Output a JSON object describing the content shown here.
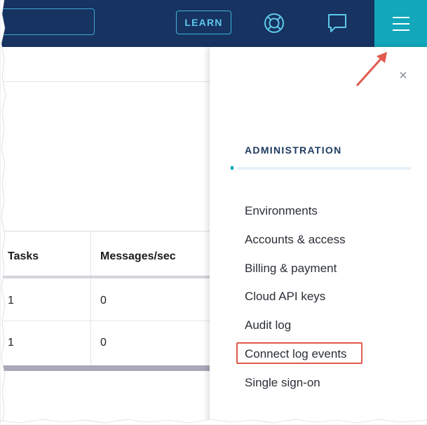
{
  "topbar": {
    "learn_label": "LEARN",
    "icons": [
      "support-lifebuoy-icon",
      "chat-icon",
      "hamburger-menu-icon"
    ],
    "colors": {
      "background": "#173361",
      "accent": "#12a7bb",
      "learn_border": "#3fb4db"
    }
  },
  "table": {
    "headers": [
      "Tasks",
      "Messages/sec"
    ],
    "rows": [
      {
        "tasks": "1",
        "messages": "0"
      },
      {
        "tasks": "1",
        "messages": "0"
      }
    ]
  },
  "panel": {
    "close_label": "×",
    "section_title": "ADMINISTRATION",
    "items": [
      {
        "label": "Environments"
      },
      {
        "label": "Accounts & access"
      },
      {
        "label": "Billing & payment"
      },
      {
        "label": "Cloud API keys"
      },
      {
        "label": "Audit log"
      },
      {
        "label": "Connect log events",
        "highlighted": true
      },
      {
        "label": "Single sign-on"
      }
    ],
    "colors": {
      "highlight_border": "#e05a4e",
      "annotation_arrow": "#e05a4e"
    }
  }
}
